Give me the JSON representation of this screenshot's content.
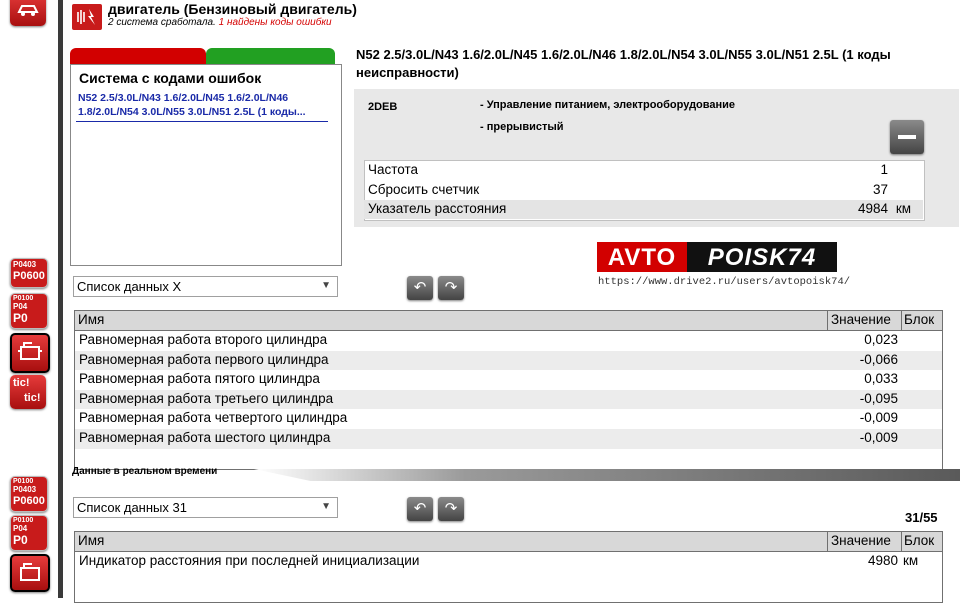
{
  "header": {
    "title": "двигатель (Бензиновый двигатель)",
    "subtitle_black": "2 система сработала.",
    "subtitle_red": "1 найдены коды ошибки"
  },
  "rail": {
    "code_icon_lines": [
      "P0100",
      "P0403",
      "P0600"
    ],
    "code_icon_short": [
      "P0100",
      "P04",
      "P0"
    ],
    "tic_labels": [
      "tic!",
      "tic!"
    ]
  },
  "systems_panel": {
    "title": "Система с кодами ошибок",
    "item": "N52 2.5/3.0L/N43 1.6/2.0L/N45 1.6/2.0L/N46 1.8/2.0L/N54 3.0L/N55 3.0L/N51 2.5L (1 коды..."
  },
  "fault": {
    "title": "N52 2.5/3.0L/N43 1.6/2.0L/N45 1.6/2.0L/N46 1.8/2.0L/N54 3.0L/N55 3.0L/N51 2.5L (1 коды неисправности)",
    "code": "2DEB",
    "description": "- Управление питанием, электрооборудование",
    "type": "- прерывистый",
    "rows": [
      {
        "label": "Частота",
        "value": "1",
        "unit": ""
      },
      {
        "label": "Сбросить счетчик",
        "value": "37",
        "unit": ""
      },
      {
        "label": "Указатель расстояния",
        "value": "4984",
        "unit": "км"
      }
    ]
  },
  "logo": {
    "red": "AVTO",
    "black": "POISK74",
    "url": "https://www.drive2.ru/users/avtopoisk74/"
  },
  "list1": {
    "dropdown": "Список данных X",
    "columns": [
      "Имя",
      "Значение",
      "Блок"
    ],
    "rows": [
      {
        "name": "Равномерная работа второго цилиндра",
        "value": "0,023",
        "unit": ""
      },
      {
        "name": "Равномерная работа первого цилиндра",
        "value": "-0,066",
        "unit": ""
      },
      {
        "name": "Равномерная работа пятого цилиндра",
        "value": "0,033",
        "unit": ""
      },
      {
        "name": "Равномерная работа третьего цилиндра",
        "value": "-0,095",
        "unit": ""
      },
      {
        "name": "Равномерная работа четвертого цилиндра",
        "value": "-0,009",
        "unit": ""
      },
      {
        "name": "Равномерная работа шестого цилиндра",
        "value": "-0,009",
        "unit": ""
      }
    ]
  },
  "realtime": {
    "label": "Данные в реальном времени"
  },
  "list2": {
    "dropdown": "Список данных 31",
    "page": "31/55",
    "columns": [
      "Имя",
      "Значение",
      "Блок"
    ],
    "rows": [
      {
        "name": "Индикатор расстояния при последней инициализации",
        "value": "4980",
        "unit": "км"
      }
    ]
  },
  "icons": {
    "back": "back-arrow-icon",
    "forward": "forward-arrow-icon",
    "minus": "minus-icon",
    "engine": "engine-warning-icon"
  }
}
